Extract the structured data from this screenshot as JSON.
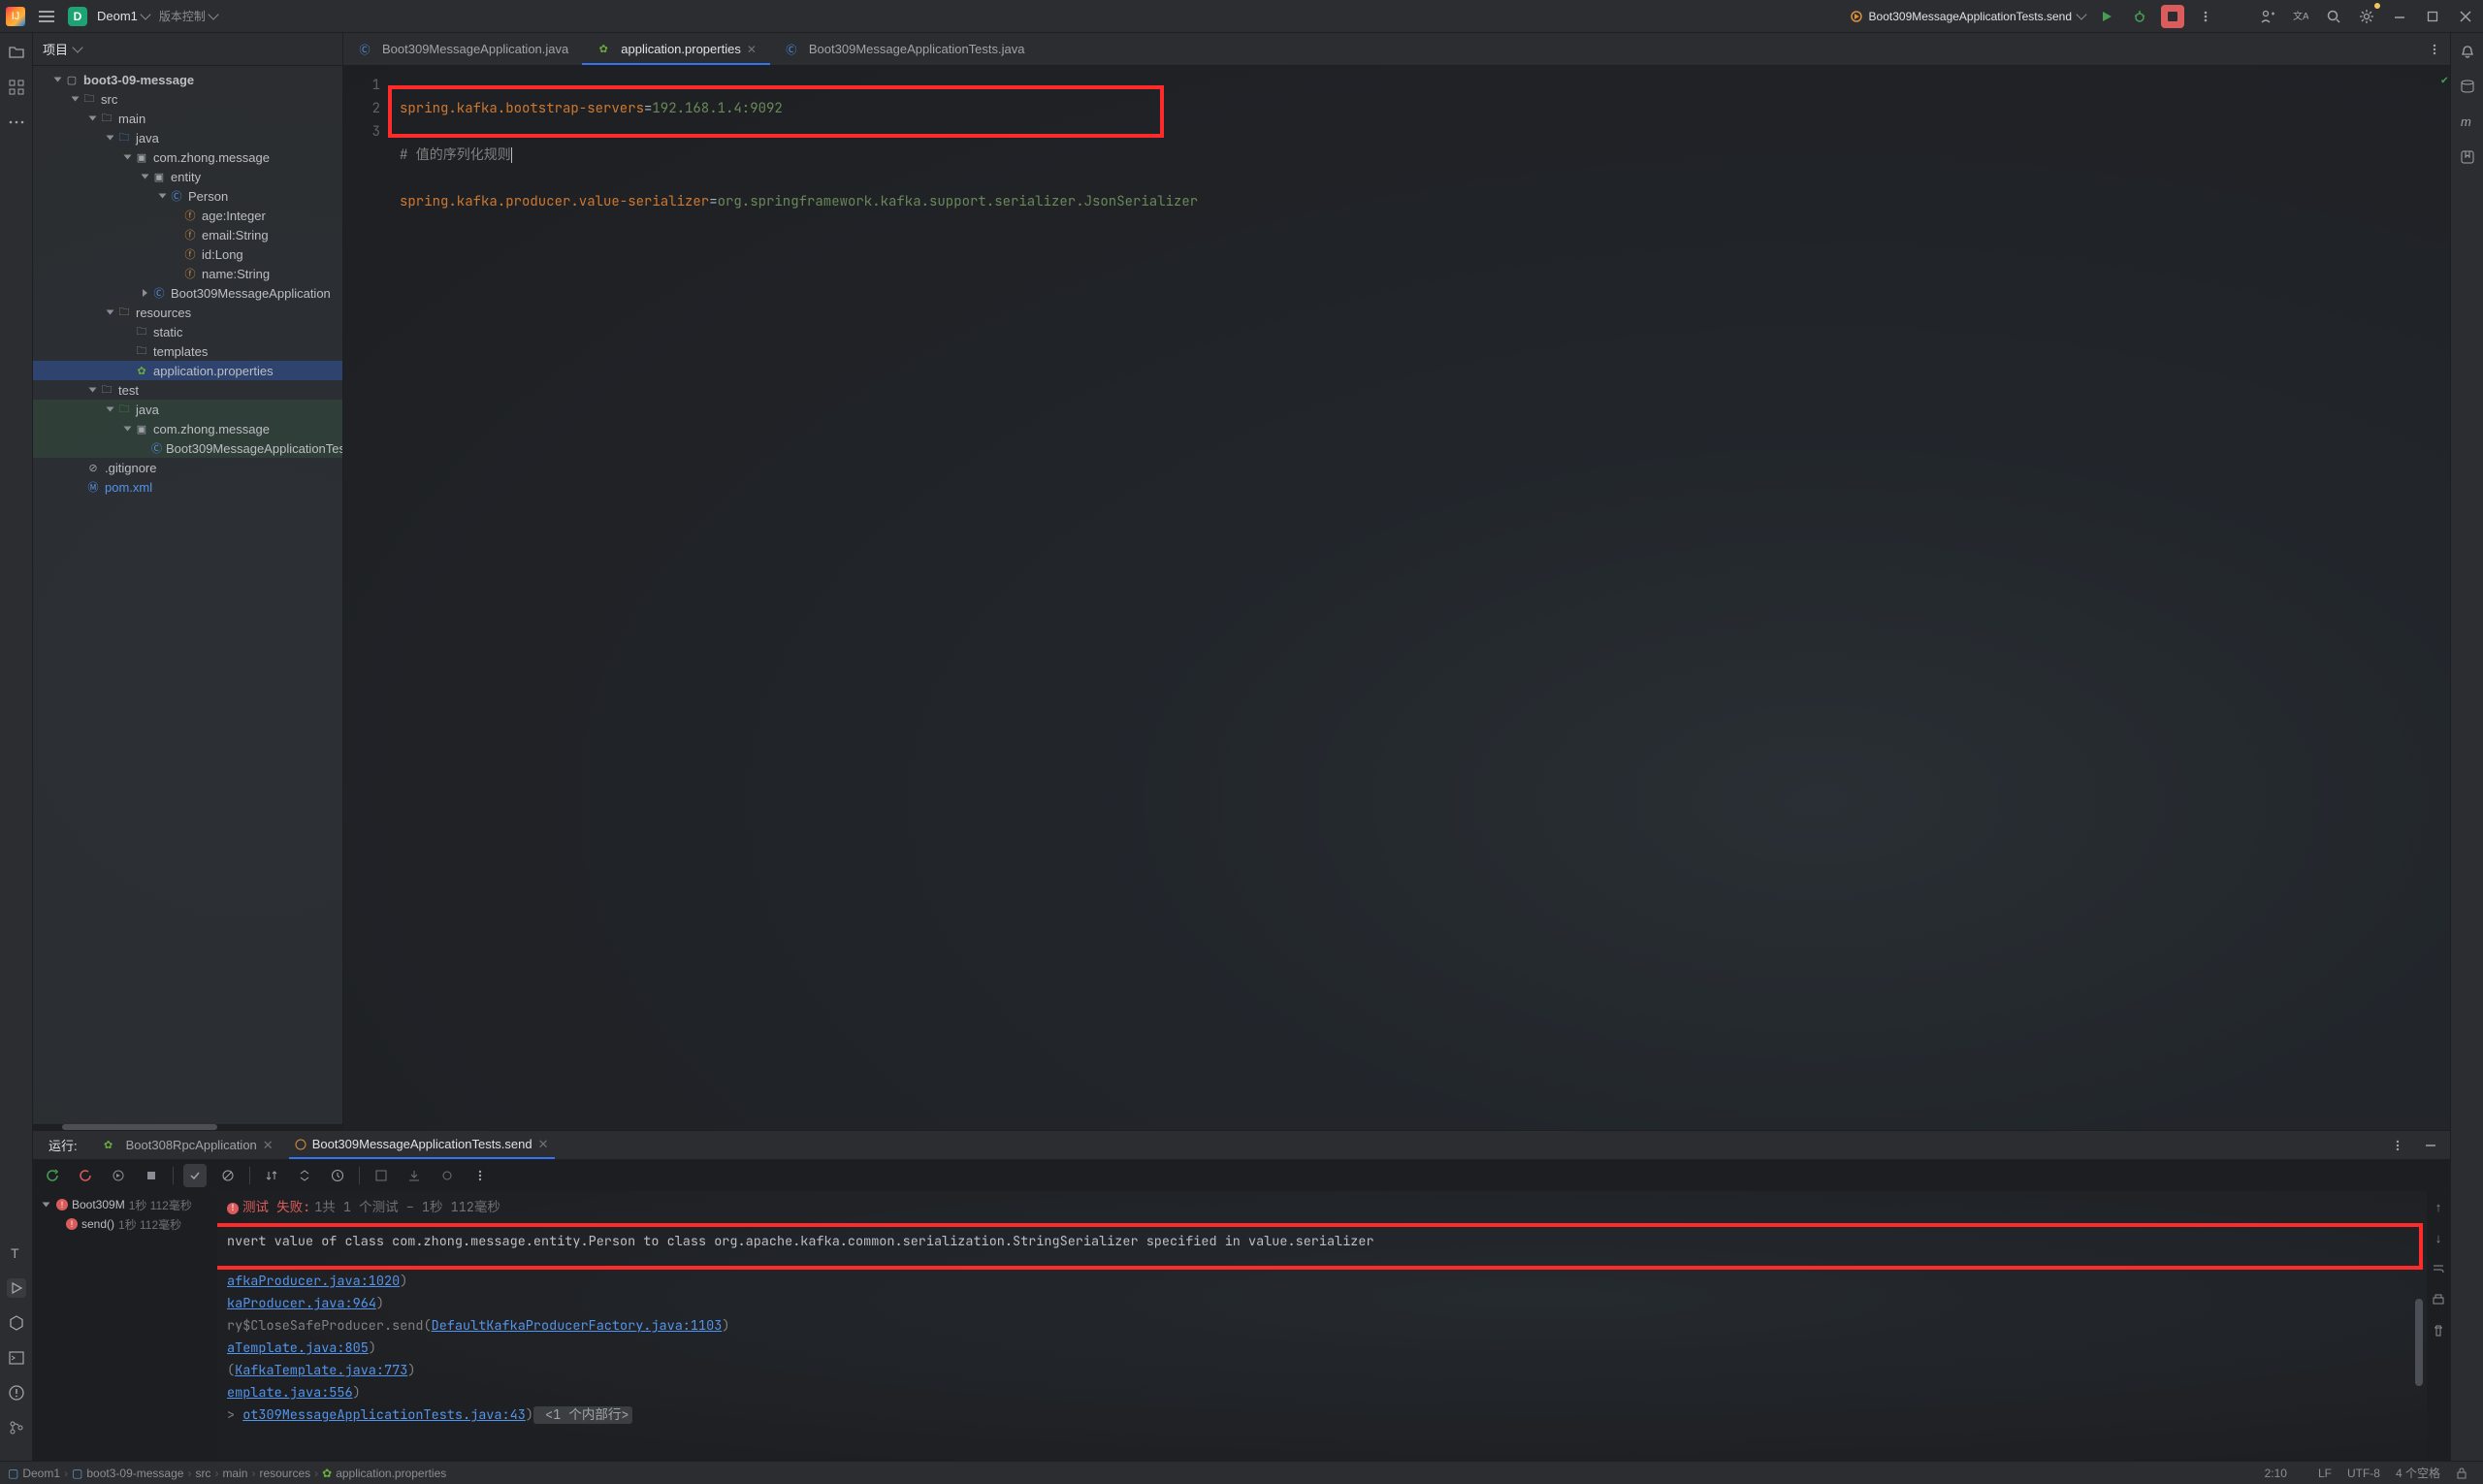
{
  "title_bar": {
    "project_initial": "D",
    "project_name": "Deom1",
    "vcs": "版本控制",
    "run_config": "Boot309MessageApplicationTests.send"
  },
  "project": {
    "header": "项目",
    "root": "boot3-09-message",
    "src": "src",
    "main": "main",
    "java": "java",
    "pkg_main": "com.zhong.message",
    "entity": "entity",
    "person": "Person",
    "field_age": "age:Integer",
    "field_email": "email:String",
    "field_id": "id:Long",
    "field_name": "name:String",
    "app_class": "Boot309MessageApplication",
    "resources": "resources",
    "static": "static",
    "templates": "templates",
    "props": "application.properties",
    "test": "test",
    "java_t": "java",
    "pkg_test": "com.zhong.message",
    "test_class": "Boot309MessageApplicationTes",
    "gitignore": ".gitignore",
    "pom": "pom.xml"
  },
  "tabs": {
    "t1": "Boot309MessageApplication.java",
    "t2": "application.properties",
    "t3": "Boot309MessageApplicationTests.java"
  },
  "code": {
    "l1_key": "spring.kafka.bootstrap-servers",
    "l1_val": "192.168.1.4:9092",
    "l2": "# 值的序列化规则",
    "l3_key": "spring.kafka.producer.value-serializer",
    "l3_val": "org.springframework.kafka.support.serializer.JsonSerializer",
    "ln1": "1",
    "ln2": "2",
    "ln3": "3"
  },
  "run": {
    "label": "运行:",
    "tab1": "Boot308RpcApplication",
    "tab2": "Boot309MessageApplicationTests.send",
    "summary_prefix": "测试 失败:",
    "summary_rest": " 1共 1 个测试 – 1秒 112毫秒",
    "tree_root": "Boot309M",
    "tree_root_time": "1秒 112毫秒",
    "tree_leaf": "send()",
    "tree_leaf_time": "1秒 112毫秒",
    "err_line": "nvert value of class com.zhong.message.entity.Person to class org.apache.kafka.common.serialization.StringSerializer specified in value.serializer",
    "c2a": "afkaProducer.java:1020",
    "c2b": ")",
    "c3a": "kaProducer.java:964",
    "c3b": ")",
    "c4a": "ry$CloseSafeProducer.send(",
    "c4b": "DefaultKafkaProducerFactory.java:1103",
    "c4c": ")",
    "c5a": "aTemplate.java:805",
    "c5b": ")",
    "c6a": "(",
    "c6b": "KafkaTemplate.java:773",
    "c6c": ")",
    "c7a": "emplate.java:556",
    "c7b": ")",
    "c8a": "ot309MessageApplicationTests.java:43",
    "c8b": ")",
    "c8c": " <1 个内部行>"
  },
  "status": {
    "crumb_root": "Deom1",
    "crumb_mod": "boot3-09-message",
    "crumb_src": "src",
    "crumb_main": "main",
    "crumb_res": "resources",
    "crumb_file": "application.properties",
    "pos": "2:10",
    "le": "LF",
    "enc": "UTF-8",
    "indent": "4 个空格"
  }
}
